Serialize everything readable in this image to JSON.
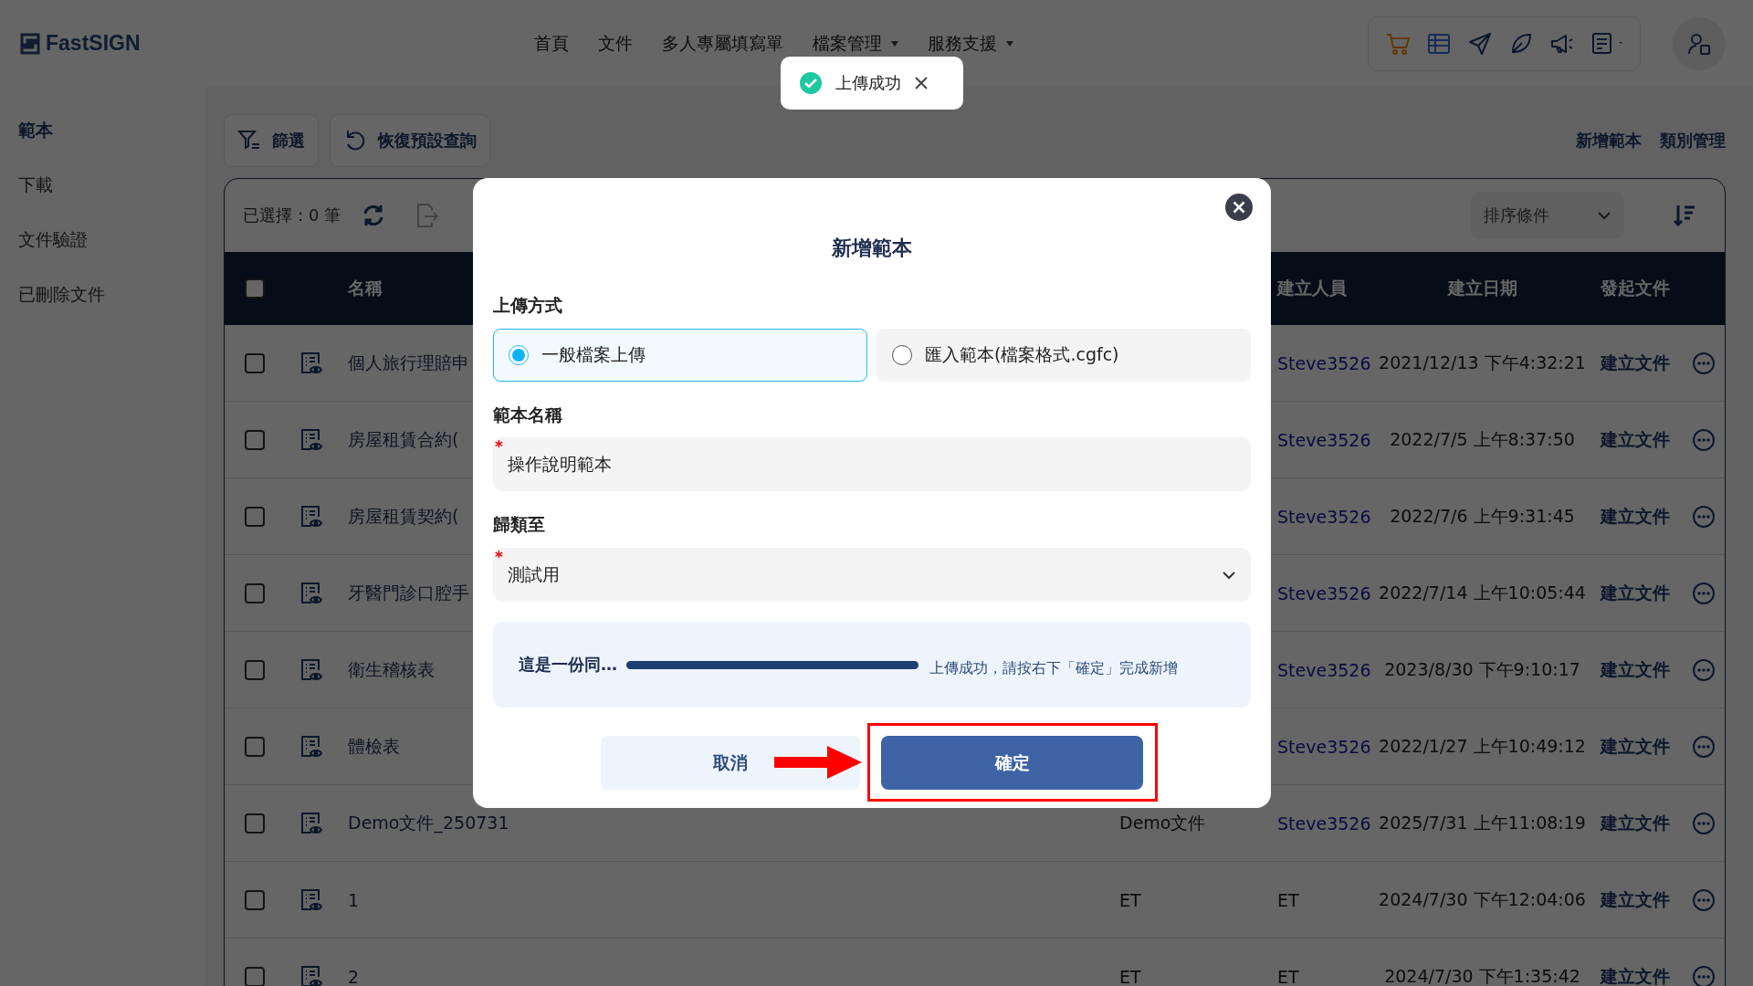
{
  "header": {
    "logo": "FastSIGN",
    "nav": [
      {
        "label": "首頁",
        "dropdown": false
      },
      {
        "label": "文件",
        "dropdown": false
      },
      {
        "label": "多人專屬填寫單",
        "dropdown": false
      },
      {
        "label": "檔案管理",
        "dropdown": true
      },
      {
        "label": "服務支援",
        "dropdown": true
      }
    ]
  },
  "toast": {
    "message": "上傳成功"
  },
  "sidebar": {
    "items": [
      {
        "label": "範本",
        "selected": true
      },
      {
        "label": "下載",
        "selected": false
      },
      {
        "label": "文件驗證",
        "selected": false
      },
      {
        "label": "已刪除文件",
        "selected": false
      }
    ]
  },
  "toolbar": {
    "buttons": [
      {
        "label": "篩選",
        "kind": "filter"
      },
      {
        "label": "恢復預設查詢",
        "kind": "reset"
      }
    ],
    "links": [
      "新增範本",
      "類別管理"
    ]
  },
  "table": {
    "selection": "已選擇：0 筆",
    "sort": {
      "placeholder": "排序條件"
    },
    "header_checked": false,
    "columns": [
      "名稱",
      "建立人員",
      "建立日期",
      "發起文件"
    ],
    "rows": [
      {
        "checked": false,
        "name": "個人旅行理賠申",
        "creator": "Steve3526",
        "creator_is_link": true,
        "date": "2021/12/13 下午4:32:21",
        "action": "建立文件"
      },
      {
        "checked": false,
        "name": "房屋租賃合約(",
        "creator": "Steve3526",
        "creator_is_link": true,
        "date": "2022/7/5 上午8:37:50",
        "action": "建立文件"
      },
      {
        "checked": false,
        "name": "房屋租賃契約(",
        "creator": "Steve3526",
        "creator_is_link": true,
        "date": "2022/7/6 上午9:31:45",
        "action": "建立文件"
      },
      {
        "checked": false,
        "name": "牙醫門診口腔手",
        "creator": "Steve3526",
        "creator_is_link": true,
        "date": "2022/7/14 上午10:05:44",
        "action": "建立文件"
      },
      {
        "checked": false,
        "name": "衛生稽核表",
        "creator": "Steve3526",
        "creator_is_link": true,
        "date": "2023/8/30 下午9:10:17",
        "action": "建立文件"
      },
      {
        "checked": false,
        "name": "體檢表",
        "creator": "Steve3526",
        "creator_is_link": true,
        "date": "2022/1/27 上午10:49:12",
        "action": "建立文件"
      },
      {
        "checked": false,
        "name": "Demo文件_250731",
        "category": "Demo文件",
        "creator": "Steve3526",
        "creator_is_link": true,
        "date": "2025/7/31 上午11:08:19",
        "action": "建立文件"
      },
      {
        "checked": false,
        "name": "1",
        "category": "ET",
        "creator": "ET",
        "creator_is_link": false,
        "date": "2024/7/30 下午12:04:06",
        "action": "建立文件"
      },
      {
        "checked": false,
        "name": "2",
        "category": "ET",
        "creator": "ET",
        "creator_is_link": false,
        "date": "2024/7/30 下午1:35:42",
        "action": "建立文件"
      }
    ]
  },
  "modal": {
    "title": "新增範本",
    "upload_method": {
      "label": "上傳方式",
      "options": [
        {
          "label": "一般檔案上傳",
          "selected": true
        },
        {
          "label": "匯入範本(檔案格式.cgfc)",
          "selected": false
        }
      ]
    },
    "name_field": {
      "label": "範本名稱",
      "value": "操作說明範本",
      "required_mark": "*"
    },
    "category_field": {
      "label": "歸類至",
      "value": "測試用",
      "required_mark": "*"
    },
    "upload": {
      "file": "這是一份同…",
      "level": 1,
      "message": "上傳成功，請按右下「確定」完成新增"
    },
    "buttons": {
      "cancel": "取消",
      "confirm": "確定"
    },
    "annotation": {
      "arrow": true,
      "highlight": true
    }
  }
}
